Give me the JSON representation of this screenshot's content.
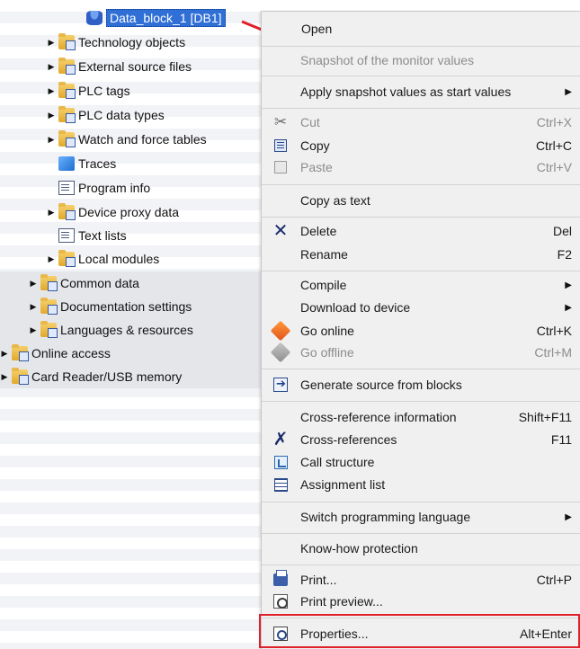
{
  "tree": {
    "items": [
      {
        "label": "Data_block_1 [DB1]",
        "icon": "data-block-icon"
      },
      {
        "label": "Technology objects",
        "icon": "technology-objects-folder-icon"
      },
      {
        "label": "External source files",
        "icon": "external-source-folder-icon"
      },
      {
        "label": "PLC tags",
        "icon": "plc-tags-folder-icon"
      },
      {
        "label": "PLC data types",
        "icon": "plc-data-types-folder-icon"
      },
      {
        "label": "Watch and force tables",
        "icon": "watch-force-folder-icon"
      },
      {
        "label": "Traces",
        "icon": "traces-icon"
      },
      {
        "label": "Program info",
        "icon": "program-info-icon"
      },
      {
        "label": "Device proxy data",
        "icon": "device-proxy-folder-icon"
      },
      {
        "label": "Text lists",
        "icon": "text-lists-icon"
      },
      {
        "label": "Local modules",
        "icon": "local-modules-folder-icon"
      },
      {
        "label": "Common data",
        "icon": "common-data-folder-icon"
      },
      {
        "label": "Documentation settings",
        "icon": "documentation-folder-icon"
      },
      {
        "label": "Languages & resources",
        "icon": "languages-folder-icon"
      },
      {
        "label": "Online access",
        "icon": "online-access-folder-icon"
      },
      {
        "label": "Card Reader/USB memory",
        "icon": "card-reader-folder-icon"
      }
    ]
  },
  "menu": {
    "open": "Open",
    "snapshot": "Snapshot of the monitor values",
    "apply_snapshot": "Apply snapshot values as start values",
    "cut": "Cut",
    "cut_shortcut": "Ctrl+X",
    "copy": "Copy",
    "copy_shortcut": "Ctrl+C",
    "paste": "Paste",
    "paste_shortcut": "Ctrl+V",
    "copy_as_text": "Copy as text",
    "delete": "Delete",
    "delete_shortcut": "Del",
    "rename": "Rename",
    "rename_shortcut": "F2",
    "compile": "Compile",
    "download": "Download to device",
    "go_online": "Go online",
    "go_online_shortcut": "Ctrl+K",
    "go_offline": "Go offline",
    "go_offline_shortcut": "Ctrl+M",
    "generate_source": "Generate source from blocks",
    "xref_info": "Cross-reference information",
    "xref_info_shortcut": "Shift+F11",
    "xrefs": "Cross-references",
    "xrefs_shortcut": "F11",
    "call_structure": "Call structure",
    "assignment_list": "Assignment list",
    "switch_language": "Switch programming language",
    "know_how": "Know-how protection",
    "print": "Print...",
    "print_shortcut": "Ctrl+P",
    "print_preview": "Print preview...",
    "properties": "Properties...",
    "properties_shortcut": "Alt+Enter"
  },
  "colors": {
    "selection": "#2f6fd6",
    "highlight_annotation": "#e0202a",
    "menu_background": "#f0f0f0"
  }
}
